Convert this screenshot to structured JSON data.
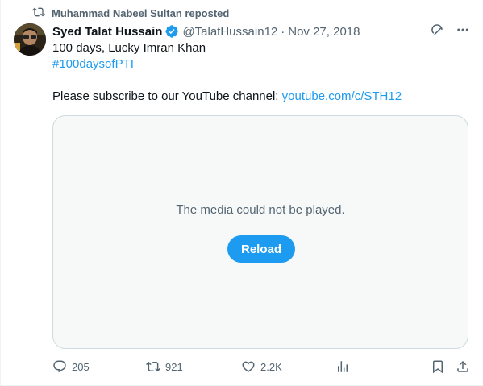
{
  "repost": {
    "label": "Muhammad Nabeel Sultan reposted"
  },
  "author": {
    "name": "Syed Talat Hussain",
    "handle": "@TalatHussain12",
    "separator": "·",
    "date": "Nov 27, 2018"
  },
  "tweet": {
    "line1": "100 days, Lucky Imran Khan",
    "hashtag": "#100daysofPTI",
    "subscribe_text": "Please subscribe to our YouTube channel: ",
    "link": "youtube.com/c/STH12"
  },
  "media": {
    "message": "The media could not be played.",
    "reload_label": "Reload"
  },
  "actions": {
    "replies": "205",
    "reposts": "921",
    "likes": "2.2K"
  },
  "colors": {
    "accent": "#1d9bf0",
    "muted": "#536471",
    "text": "#0f1419",
    "border": "#cfd9de"
  }
}
